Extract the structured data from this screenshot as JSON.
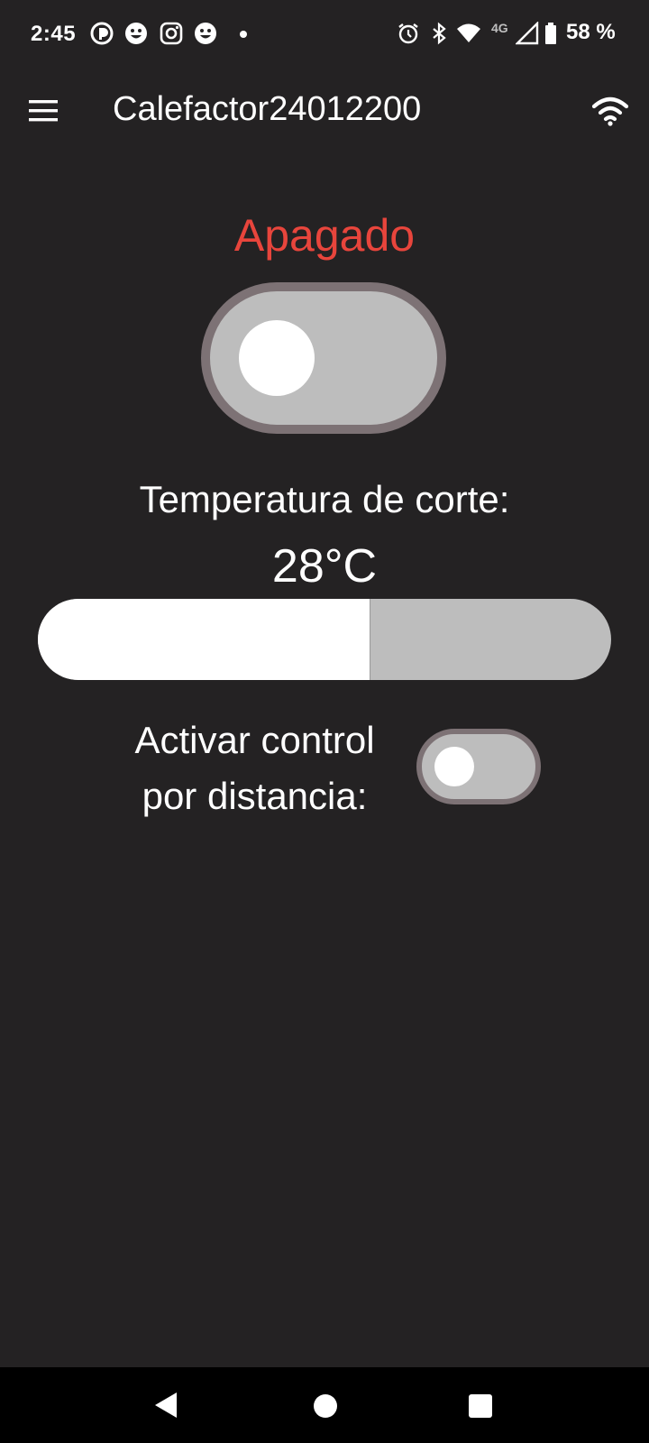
{
  "status_bar": {
    "time": "2:45",
    "network": "4G",
    "battery": "58 %",
    "icons": [
      "app-notification-icon",
      "smiley-icon",
      "instagram-icon",
      "smiley-icon",
      "dot",
      "alarm-icon",
      "bluetooth-icon",
      "wifi-icon",
      "cell-signal-icon",
      "battery-icon"
    ]
  },
  "app_bar": {
    "title": "Calefactor24012200",
    "menu_icon": "hamburger-menu-icon",
    "connection_icon": "wifi-icon"
  },
  "main": {
    "status_text": "Apagado",
    "status_color": "#e8453c",
    "power_switch": {
      "on": false
    },
    "temperature_heading": "Temperatura de corte:",
    "temperature_value": "28°C",
    "slider": {
      "fraction": 0.58
    },
    "remote_label_line1": "Activar control",
    "remote_label_line2": "por distancia:",
    "remote_switch": {
      "on": false
    }
  },
  "colors": {
    "background": "#242223",
    "toggle_track": "#bdbdbd",
    "toggle_border": "#7d7275"
  },
  "nav_bar": {
    "icons": [
      "back-icon",
      "home-icon",
      "recents-icon"
    ]
  }
}
